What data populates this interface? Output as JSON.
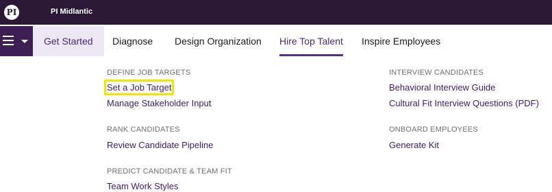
{
  "header": {
    "logo_text": "PI",
    "company": "PI Midlantic"
  },
  "nav": {
    "tabs": [
      {
        "label": "Get Started"
      },
      {
        "label": "Diagnose"
      },
      {
        "label": "Design Organization"
      },
      {
        "label": "Hire Top Talent"
      },
      {
        "label": "Inspire Employees"
      }
    ],
    "active_tab": "Hire Top Talent"
  },
  "sections": {
    "define_job_targets": {
      "title": "DEFINE JOB TARGETS",
      "links": [
        "Set a Job Target",
        "Manage Stakeholder Input"
      ]
    },
    "rank_candidates": {
      "title": "RANK CANDIDATES",
      "links": [
        "Review Candidate Pipeline"
      ]
    },
    "predict_fit": {
      "title": "PREDICT CANDIDATE & TEAM FIT",
      "links": [
        "Team Work Styles"
      ]
    },
    "interview_candidates": {
      "title": "INTERVIEW CANDIDATES",
      "links": [
        "Behavioral Interview Guide",
        "Cultural Fit Interview Questions (PDF)"
      ]
    },
    "onboard_employees": {
      "title": "ONBOARD EMPLOYEES",
      "links": [
        "Generate Kit"
      ]
    }
  },
  "colors": {
    "topbar": "#2b1736",
    "accent": "#5b2d8e",
    "link": "#3c1d6e",
    "highlight": "#f2e600"
  }
}
